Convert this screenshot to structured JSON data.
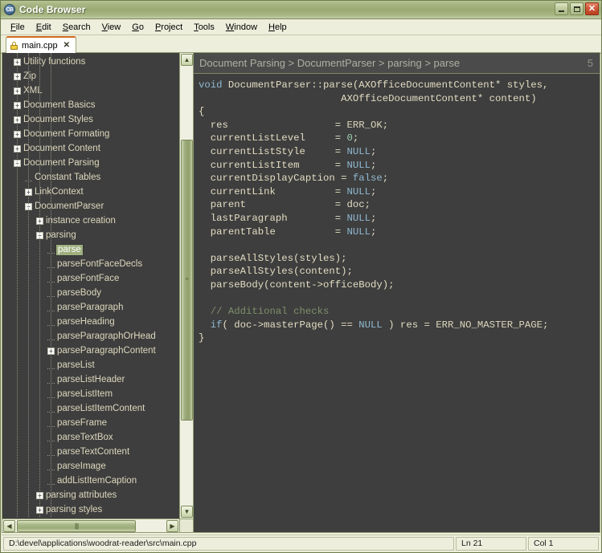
{
  "window": {
    "title": "Code Browser",
    "app_icon": "app-icon-cb",
    "icon_text": "CB",
    "minimize_label": "Minimize",
    "maximize_label": "Maximize",
    "close_label": "Close"
  },
  "menubar": {
    "items": [
      {
        "label": "File",
        "accel": "F"
      },
      {
        "label": "Edit",
        "accel": "E"
      },
      {
        "label": "Search",
        "accel": "S"
      },
      {
        "label": "View",
        "accel": "V"
      },
      {
        "label": "Go",
        "accel": "G"
      },
      {
        "label": "Project",
        "accel": "P"
      },
      {
        "label": "Tools",
        "accel": "T"
      },
      {
        "label": "Window",
        "accel": "W"
      },
      {
        "label": "Help",
        "accel": "H"
      }
    ]
  },
  "tabs": {
    "items": [
      {
        "label": "main.cpp",
        "icon": "lock-icon",
        "close": "✕",
        "active": true
      }
    ]
  },
  "tree": {
    "nodes": [
      {
        "label": "Utility functions",
        "indent": 0,
        "state": "collapsed"
      },
      {
        "label": "Zip",
        "indent": 0,
        "state": "collapsed"
      },
      {
        "label": "XML",
        "indent": 0,
        "state": "collapsed"
      },
      {
        "label": "Document Basics",
        "indent": 0,
        "state": "collapsed"
      },
      {
        "label": "Document Styles",
        "indent": 0,
        "state": "collapsed"
      },
      {
        "label": "Document Formating",
        "indent": 0,
        "state": "collapsed"
      },
      {
        "label": "Document Content",
        "indent": 0,
        "state": "collapsed"
      },
      {
        "label": "Document Parsing",
        "indent": 0,
        "state": "expanded"
      },
      {
        "label": "Constant Tables",
        "indent": 1,
        "state": "leaf"
      },
      {
        "label": "LinkContext",
        "indent": 1,
        "state": "collapsed"
      },
      {
        "label": "DocumentParser",
        "indent": 1,
        "state": "expanded"
      },
      {
        "label": "instance creation",
        "indent": 2,
        "state": "collapsed"
      },
      {
        "label": "parsing",
        "indent": 2,
        "state": "expanded"
      },
      {
        "label": "parse",
        "indent": 3,
        "state": "leaf",
        "selected": true
      },
      {
        "label": "parseFontFaceDecls",
        "indent": 3,
        "state": "leaf"
      },
      {
        "label": "parseFontFace",
        "indent": 3,
        "state": "leaf"
      },
      {
        "label": "parseBody",
        "indent": 3,
        "state": "leaf"
      },
      {
        "label": "parseParagraph",
        "indent": 3,
        "state": "leaf"
      },
      {
        "label": "parseHeading",
        "indent": 3,
        "state": "leaf"
      },
      {
        "label": "parseParagraphOrHead",
        "indent": 3,
        "state": "leaf"
      },
      {
        "label": "parseParagraphContent",
        "indent": 3,
        "state": "collapsed"
      },
      {
        "label": "parseList",
        "indent": 3,
        "state": "leaf"
      },
      {
        "label": "parseListHeader",
        "indent": 3,
        "state": "leaf"
      },
      {
        "label": "parseListItem",
        "indent": 3,
        "state": "leaf"
      },
      {
        "label": "parseListItemContent",
        "indent": 3,
        "state": "leaf"
      },
      {
        "label": "parseFrame",
        "indent": 3,
        "state": "leaf"
      },
      {
        "label": "parseTextBox",
        "indent": 3,
        "state": "leaf"
      },
      {
        "label": "parseTextContent",
        "indent": 3,
        "state": "leaf"
      },
      {
        "label": "parseImage",
        "indent": 3,
        "state": "leaf"
      },
      {
        "label": "addListItemCaption",
        "indent": 3,
        "state": "leaf"
      },
      {
        "label": "parsing attributes",
        "indent": 2,
        "state": "collapsed"
      },
      {
        "label": "parsing styles",
        "indent": 2,
        "state": "collapsed"
      }
    ],
    "scrollbar": {
      "up_arrow": "▲",
      "down_arrow": "▼",
      "left_arrow": "◀",
      "right_arrow": "▶",
      "grip_v": "≡",
      "grip_h": "||||"
    }
  },
  "editor": {
    "breadcrumb": "Document Parsing > DocumentParser > parsing > parse",
    "breadcrumb_count": "5",
    "code_lines": [
      [
        {
          "t": "kw",
          "s": "void"
        },
        {
          "t": "pln",
          "s": " DocumentParser::parse(AXOfficeDocumentContent* styles,"
        }
      ],
      [
        {
          "t": "pln",
          "s": "                        AXOfficeDocumentContent* content)"
        }
      ],
      [
        {
          "t": "pln",
          "s": "{"
        }
      ],
      [
        {
          "t": "pln",
          "s": "  res                  = "
        },
        {
          "t": "macro",
          "s": "ERR_OK;"
        }
      ],
      [
        {
          "t": "pln",
          "s": "  currentListLevel     = "
        },
        {
          "t": "num",
          "s": "0"
        },
        {
          "t": "pln",
          "s": ";"
        }
      ],
      [
        {
          "t": "pln",
          "s": "  currentListStyle     = "
        },
        {
          "t": "kw",
          "s": "NULL"
        },
        {
          "t": "pln",
          "s": ";"
        }
      ],
      [
        {
          "t": "pln",
          "s": "  currentListItem      = "
        },
        {
          "t": "kw",
          "s": "NULL"
        },
        {
          "t": "pln",
          "s": ";"
        }
      ],
      [
        {
          "t": "pln",
          "s": "  currentDisplayCaption = "
        },
        {
          "t": "kw",
          "s": "false"
        },
        {
          "t": "pln",
          "s": ";"
        }
      ],
      [
        {
          "t": "pln",
          "s": "  currentLink          = "
        },
        {
          "t": "kw",
          "s": "NULL"
        },
        {
          "t": "pln",
          "s": ";"
        }
      ],
      [
        {
          "t": "pln",
          "s": "  parent               = doc;"
        }
      ],
      [
        {
          "t": "pln",
          "s": "  lastParagraph        = "
        },
        {
          "t": "kw",
          "s": "NULL"
        },
        {
          "t": "pln",
          "s": ";"
        }
      ],
      [
        {
          "t": "pln",
          "s": "  parentTable          = "
        },
        {
          "t": "kw",
          "s": "NULL"
        },
        {
          "t": "pln",
          "s": ";"
        }
      ],
      [
        {
          "t": "pln",
          "s": ""
        }
      ],
      [
        {
          "t": "pln",
          "s": "  parseAllStyles(styles);"
        }
      ],
      [
        {
          "t": "pln",
          "s": "  parseAllStyles(content);"
        }
      ],
      [
        {
          "t": "pln",
          "s": "  parseBody(content->officeBody);"
        }
      ],
      [
        {
          "t": "pln",
          "s": ""
        }
      ],
      [
        {
          "t": "cmt",
          "s": "  // Additional checks"
        }
      ],
      [
        {
          "t": "kw",
          "s": "  if"
        },
        {
          "t": "pln",
          "s": "( doc->masterPage() == "
        },
        {
          "t": "kw",
          "s": "NULL"
        },
        {
          "t": "pln",
          "s": " ) res = "
        },
        {
          "t": "macro",
          "s": "ERR_NO_MASTER_PAGE"
        },
        {
          "t": "pln",
          "s": ";"
        }
      ],
      [
        {
          "t": "pln",
          "s": "}"
        }
      ]
    ]
  },
  "statusbar": {
    "path": "D:\\devel\\applications\\woodrat-reader\\src\\main.cpp",
    "line": "Ln 21",
    "column": "Col 1"
  }
}
